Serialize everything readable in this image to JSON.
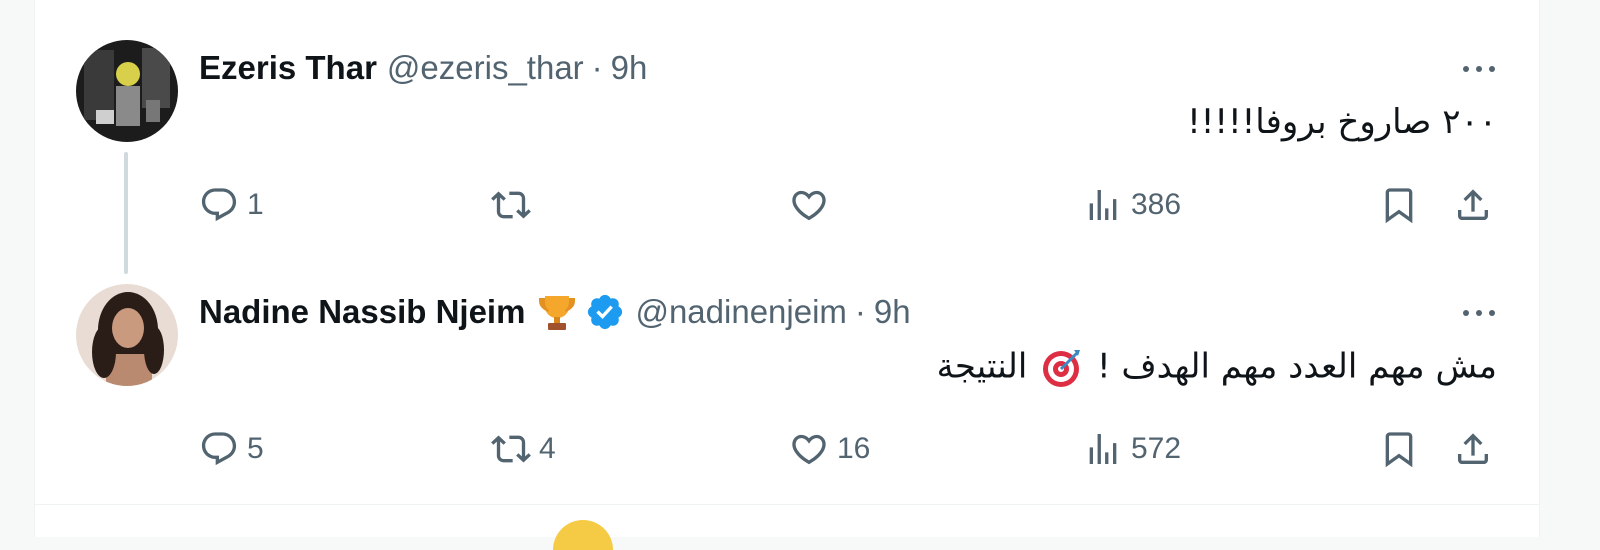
{
  "tweets": [
    {
      "name": "Ezeris Thar",
      "handle": "@ezeris_thar",
      "separator": "·",
      "time": "9h",
      "text": "٢٠٠ صاروخ بروفا!!!!!",
      "stats": {
        "replies": "1",
        "retweets": "",
        "likes": "",
        "views": "386"
      }
    },
    {
      "name": "Nadine Nassib Njeim",
      "handle": "@nadinenjeim",
      "separator": "·",
      "time": "9h",
      "text_before_emoji": "مش مهم العدد مهم الهدف !",
      "text_after_emoji": "النتيجة",
      "stats": {
        "replies": "5",
        "retweets": "4",
        "likes": "16",
        "views": "572"
      }
    }
  ],
  "icons": {
    "more": "more-icon",
    "reply": "reply-icon",
    "retweet": "retweet-icon",
    "like": "heart-icon",
    "views": "views-icon",
    "bookmark": "bookmark-icon",
    "share": "share-icon",
    "trophy": "trophy-emoji-icon",
    "verified": "verified-badge-icon",
    "target": "direct-hit-emoji-icon"
  },
  "colors": {
    "text": "#0f1419",
    "secondary": "#536471",
    "verified": "#1d9bf0",
    "thread_line": "#cfd9de"
  }
}
